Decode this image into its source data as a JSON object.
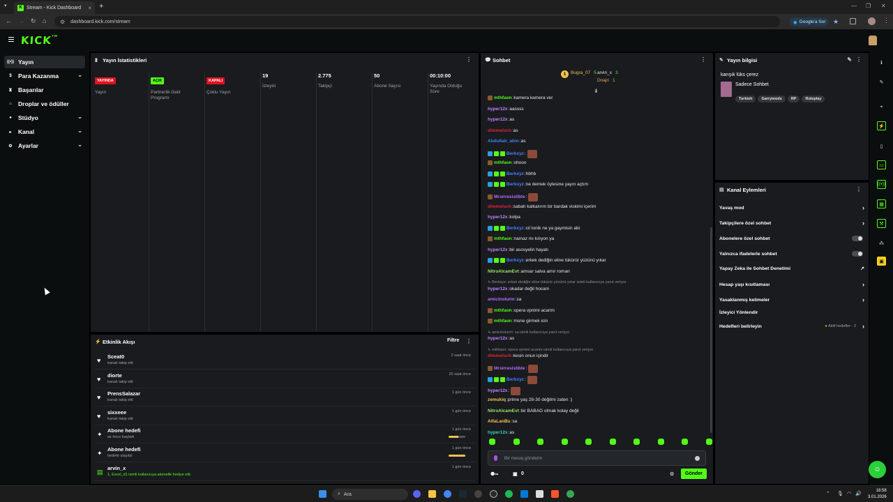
{
  "browser": {
    "tab_title": "Stream - Kick Dashboard",
    "tab_favicon": "K",
    "url": "dashboard.kick.com/stream",
    "google_sor": "Google'a Sor"
  },
  "brand": {
    "logo": "KICK",
    "accent": "#53fc18"
  },
  "sidebar": {
    "items": [
      {
        "label": "Yayın",
        "icon": "broadcast-icon",
        "active": true,
        "expandable": false
      },
      {
        "label": "Para Kazanma",
        "icon": "money-icon",
        "active": false,
        "expandable": true
      },
      {
        "label": "Başarılar",
        "icon": "trophy-icon",
        "active": false,
        "expandable": false
      },
      {
        "label": "Droplar ve ödüller",
        "icon": "gift-icon",
        "active": false,
        "expandable": false
      },
      {
        "label": "Stüdyo",
        "icon": "studio-icon",
        "active": false,
        "expandable": true
      },
      {
        "label": "Kanal",
        "icon": "channel-icon",
        "active": false,
        "expandable": true
      },
      {
        "label": "Ayarlar",
        "icon": "gear-icon",
        "active": false,
        "expandable": true
      }
    ]
  },
  "stats": {
    "title": "Yayın İstatistikleri",
    "columns": [
      {
        "value": "YAYINDA",
        "kind": "badge-red",
        "label": "Yayın"
      },
      {
        "value": "AÇIK",
        "kind": "badge-green",
        "label": "Partnerlik Gelir Programı"
      },
      {
        "value": "KAPALI",
        "kind": "badge-red",
        "label": "Çoklu Yayın"
      },
      {
        "value": "19",
        "kind": "number",
        "label": "İzleyici"
      },
      {
        "value": "2.775",
        "kind": "number",
        "label": "Takipçi"
      },
      {
        "value": "50",
        "kind": "number",
        "label": "Abone Sayısı"
      },
      {
        "value": "00:10:00",
        "kind": "number",
        "label": "Yayında Olduğu Süre"
      }
    ]
  },
  "activity": {
    "title": "Etkinlik Akışı",
    "filter_label": "Filtre",
    "rows": [
      {
        "name": "Sceat0",
        "sub": "kanalı takip etti",
        "time": "2 saat önce",
        "icon": "heart-icon",
        "progress": null
      },
      {
        "name": "diorte",
        "sub": "kanalı takip etti",
        "time": "20 saat önce",
        "icon": "heart-icon",
        "progress": null
      },
      {
        "name": "PrensSalazar",
        "sub": "kanalı takip etti",
        "time": "1 gün önce",
        "icon": "heart-icon",
        "progress": null
      },
      {
        "name": "sixxeee",
        "sub": "kanalı takip etti",
        "time": "1 gün önce",
        "icon": "heart-icon",
        "progress": null
      },
      {
        "name": "Abone hedefi",
        "sub": "az önce başladı",
        "time": "1 gün önce",
        "icon": "sparkle-icon",
        "progress": 0.6
      },
      {
        "name": "Abone hedefi",
        "sub": "hedefe ulaşıldı",
        "time": "1 gün önce",
        "icon": "sparkle-icon",
        "progress": 1.0
      },
      {
        "name": "arvin_x",
        "sub": "1, Excel_d1 isimli kullanıcıya abonelik hediye etti.",
        "time": "1 gün önce",
        "icon": "gift-sub-icon",
        "progress": null
      }
    ]
  },
  "chat": {
    "title": "Sohbet",
    "top_gifters": [
      {
        "rank": "1",
        "name": "Bugra_07",
        "count": "5",
        "color": "#f2c14e"
      },
      {
        "rank": "",
        "name": "arvin_x",
        "count": "3",
        "color": "#e6e6e6"
      },
      {
        "rank": "",
        "name": "Dnajri",
        "count": "1",
        "color": "#f2a65a"
      }
    ],
    "messages": [
      {
        "type": "msg",
        "user": "mthfaon",
        "color": "#53fc18",
        "badges": [
          "#8a5a2b"
        ],
        "text": "kamera kamera ver",
        "emote": false
      },
      {
        "type": "msg",
        "user": "hyper12x",
        "color": "#c084fc",
        "badges": [],
        "text": "aassss",
        "emote": false
      },
      {
        "type": "msg",
        "user": "hyper12x",
        "color": "#c084fc",
        "badges": [],
        "text": "as",
        "emote": false
      },
      {
        "type": "msg",
        "user": "dimmelsch",
        "color": "#e0243c",
        "badges": [],
        "text": "as",
        "emote": false
      },
      {
        "type": "msg",
        "user": "Abdullah_abin",
        "color": "#3b82f6",
        "badges": [],
        "text": "as",
        "emote": false
      },
      {
        "type": "msg",
        "user": "Berkxyz",
        "color": "#4a7dff",
        "badges": [
          "#2aa0e0",
          "#53fc18",
          "#53fc18"
        ],
        "text": "",
        "emote": true
      },
      {
        "type": "msg",
        "user": "mthfaon",
        "color": "#53fc18",
        "badges": [
          "#8a5a2b"
        ],
        "text": "ohooo",
        "emote": false
      },
      {
        "type": "msg",
        "user": "Berkxyz",
        "color": "#4a7dff",
        "badges": [
          "#2aa0e0",
          "#53fc18",
          "#53fc18"
        ],
        "text": "hbhb",
        "emote": false
      },
      {
        "type": "msg",
        "user": "Berkxyz",
        "color": "#4a7dff",
        "badges": [
          "#2aa0e0",
          "#53fc18",
          "#53fc18"
        ],
        "text": "ne demek öylesine yayın açtım",
        "emote": false
      },
      {
        "type": "msg",
        "user": "Mrsirresistible",
        "color": "#b86bff",
        "badges": [
          "#8a5a2b"
        ],
        "text": "",
        "emote": true
      },
      {
        "type": "msg",
        "user": "dimmelsch",
        "color": "#e0243c",
        "badges": [],
        "text": "sabah kalkalırım bir bardak viskimi içerim",
        "emote": false
      },
      {
        "type": "msg",
        "user": "hyper12x",
        "color": "#c084fc",
        "badges": [],
        "text": "kolpa",
        "emote": false
      },
      {
        "type": "msg",
        "user": "Berkxyz",
        "color": "#4a7dff",
        "badges": [
          "#2aa0e0",
          "#53fc18",
          "#53fc18"
        ],
        "text": "cil tonik ne ya gaymisin abi",
        "emote": false
      },
      {
        "type": "msg",
        "user": "mthfaon",
        "color": "#53fc18",
        "badges": [
          "#8a5a2b"
        ],
        "text": "namaz mı kılıyon ya",
        "emote": false
      },
      {
        "type": "msg",
        "user": "hyper12x",
        "color": "#c084fc",
        "badges": [],
        "text": "bir asosyelin hayatı",
        "emote": false
      },
      {
        "type": "msg",
        "user": "Berkxyz",
        "color": "#4a7dff",
        "badges": [
          "#2aa0e0",
          "#53fc18",
          "#53fc18"
        ],
        "text": "erkek dediğin eline tükürür yüzünü yıkar",
        "emote": false
      },
      {
        "type": "msg",
        "user": "NitroAlcamEvt",
        "color": "#9be564",
        "badges": [],
        "text": "amsar salva amır roman",
        "emote": false
      },
      {
        "type": "reply",
        "text": "Berkxyz: erkek dediğin eline tükürür yüzünü yıkar isimli kullanıcıya yanıt veriyor"
      },
      {
        "type": "msg",
        "user": "hyper12x",
        "color": "#c084fc",
        "badges": [],
        "text": "okadar değil hocam",
        "emote": false
      },
      {
        "type": "msg",
        "user": "amicinolurm",
        "color": "#b86bff",
        "badges": [],
        "text": "sa",
        "emote": false
      },
      {
        "type": "msg",
        "user": "mthfaon",
        "color": "#53fc18",
        "badges": [
          "#8a5a2b"
        ],
        "text": "opera vpnimi acarim",
        "emote": false
      },
      {
        "type": "msg",
        "user": "mthfaon",
        "color": "#53fc18",
        "badges": [
          "#8a5a2b"
        ],
        "text": "msne girmek icin",
        "emote": false
      },
      {
        "type": "reply",
        "text": "amicinolurm: sa isimli kullanıcıya yanıt veriyor"
      },
      {
        "type": "msg",
        "user": "hyper12x",
        "color": "#c084fc",
        "badges": [],
        "text": "as",
        "emote": false
      },
      {
        "type": "reply",
        "text": "mthfaon: opera vpnimi acarim isimli kullanıcıya yanıt veriyor"
      },
      {
        "type": "msg",
        "user": "dimmelsch",
        "color": "#e0243c",
        "badges": [],
        "text": "kesin onun içindir",
        "emote": false
      },
      {
        "type": "msg",
        "user": "Mrsirresistible",
        "color": "#b86bff",
        "badges": [
          "#8a5a2b"
        ],
        "text": "",
        "emote": true
      },
      {
        "type": "msg",
        "user": "Berkxyz",
        "color": "#4a7dff",
        "badges": [
          "#2aa0e0",
          "#53fc18",
          "#53fc18"
        ],
        "text": "",
        "emote": true
      },
      {
        "type": "msg",
        "user": "hyper12x",
        "color": "#c084fc",
        "badges": [],
        "text": "",
        "emote": true
      },
      {
        "type": "msg",
        "user": "zemukiq",
        "color": "#f2c14e",
        "badges": [],
        "text": "prime yaş 28-30 değilmi zaten :)",
        "emote": false
      },
      {
        "type": "msg",
        "user": "NitroAlcamEvt",
        "color": "#9be564",
        "badges": [],
        "text": "bir BABAG olmak kolay değil",
        "emote": false
      },
      {
        "type": "msg",
        "user": "AlfaLanBu",
        "color": "#f2c14e",
        "badges": [],
        "text": "sa",
        "emote": false
      },
      {
        "type": "msg",
        "user": "hyper12x",
        "color": "#2dd4bf",
        "badges": [],
        "text": "as",
        "emote": false
      }
    ],
    "input_placeholder": "Bir mesaj gönderin",
    "send_label": "Gönder",
    "viewer_count": "0"
  },
  "stream_info": {
    "title": "Yayın bilgisi",
    "stream_title": "karışık lüks çerez",
    "category": "Sadece Sohbet",
    "tags": [
      "Turkish",
      "Garrymods",
      "RP",
      "Roleplay"
    ]
  },
  "channel_actions": {
    "title": "Kanal Eylemleri",
    "items": [
      {
        "label": "Yavaş mod",
        "control": "arrow"
      },
      {
        "label": "Takipçilere özel sohbet",
        "control": "arrow"
      },
      {
        "label": "Abonelere özel sohbet",
        "control": "toggle"
      },
      {
        "label": "Yalnızca ifadelerle sohbet",
        "control": "toggle"
      },
      {
        "label": "Yapay Zeka ile Sohbet Denetimi",
        "control": "external"
      },
      {
        "label": "Hesap yaşı kısıtlaması",
        "control": "arrow"
      },
      {
        "label": "Yasaklanmış kelimeler",
        "control": "arrow"
      },
      {
        "label": "İzleyici Yönlendir",
        "control": "none"
      },
      {
        "label": "Hedefleri belirleyin",
        "control": "arrow",
        "extra": "Aktif hedefler - 2"
      }
    ]
  },
  "taskbar": {
    "search_label": "Ara",
    "time": "18:58",
    "date": "3.01.2026"
  }
}
